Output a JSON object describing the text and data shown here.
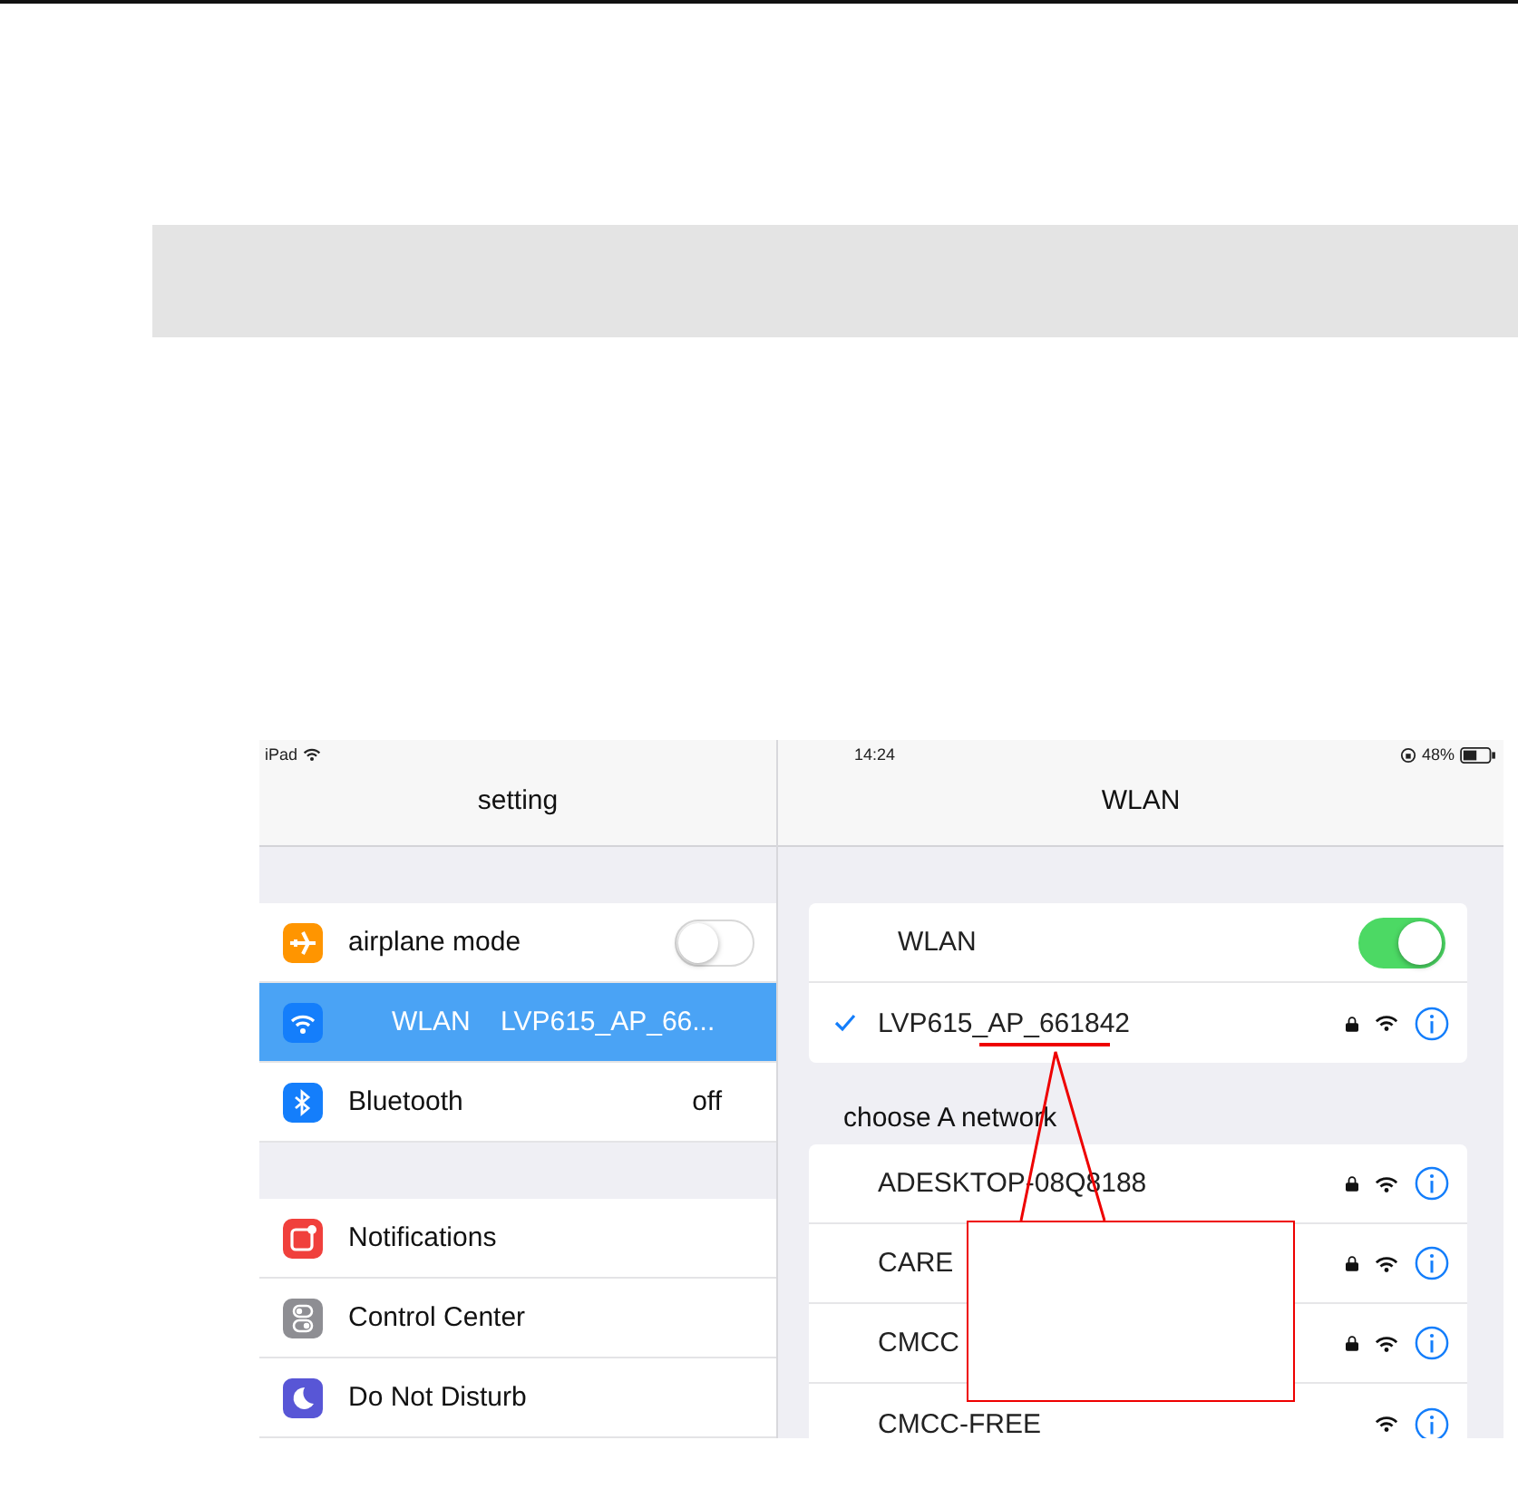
{
  "screenshot": {
    "left_pane": {
      "status": {
        "carrier": "iPad"
      },
      "title": "setting",
      "groups": [
        [
          {
            "kind": "toggle",
            "label": "airplane mode",
            "on": false,
            "selected": false,
            "color": "#ff9500"
          },
          {
            "kind": "value",
            "label": "WLAN",
            "value": "LVP615_AP_66...",
            "selected": true,
            "color": "#147efb"
          },
          {
            "kind": "value",
            "label": "Bluetooth",
            "value": "off",
            "selected": false,
            "color": "#147efb"
          }
        ],
        [
          {
            "kind": "link",
            "label": "Notifications",
            "selected": false,
            "color": "#f0403c"
          },
          {
            "kind": "link",
            "label": "Control Center",
            "selected": false,
            "color": "#8e8e93"
          },
          {
            "kind": "link",
            "label": "Do Not Disturb",
            "selected": false,
            "color": "#5856d6"
          }
        ]
      ]
    },
    "right_pane": {
      "status": {
        "time": "14:24",
        "battery": "48%"
      },
      "title": "WLAN",
      "wlan_toggle": {
        "label": "WLAN",
        "on": true
      },
      "connected": {
        "name": "LVP615_AP_661842",
        "checked": true,
        "locked": true
      },
      "section_label": "choose A network",
      "networks": [
        {
          "name": "ADESKTOP-08Q8188",
          "locked": true
        },
        {
          "name": "CARE",
          "locked": true
        },
        {
          "name": "CMCC",
          "locked": true
        },
        {
          "name": "CMCC-FREE",
          "locked": false
        }
      ]
    }
  }
}
